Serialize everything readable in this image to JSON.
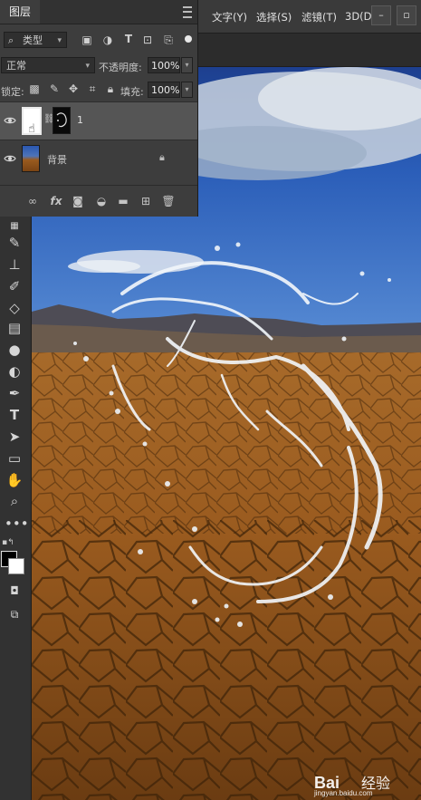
{
  "menubar": {
    "items": [
      "文字(Y)",
      "选择(S)",
      "滤镜(T)",
      "3D(D"
    ]
  },
  "layers_panel": {
    "tab_label": "图层",
    "filter_kind": "类型",
    "blend_mode": "正常",
    "opacity_label": "不透明度:",
    "opacity_value": "100%",
    "lock_label": "锁定:",
    "fill_label": "填充:",
    "fill_value": "100%",
    "layers": [
      {
        "name": "1",
        "selected": true
      },
      {
        "name": "背景",
        "selected": false
      }
    ]
  },
  "watermark": {
    "brand": "Bai",
    "brand_cn": "经验",
    "url": "jingyan.baidu.com"
  },
  "colors": {
    "accent": "#3a7bd5"
  }
}
